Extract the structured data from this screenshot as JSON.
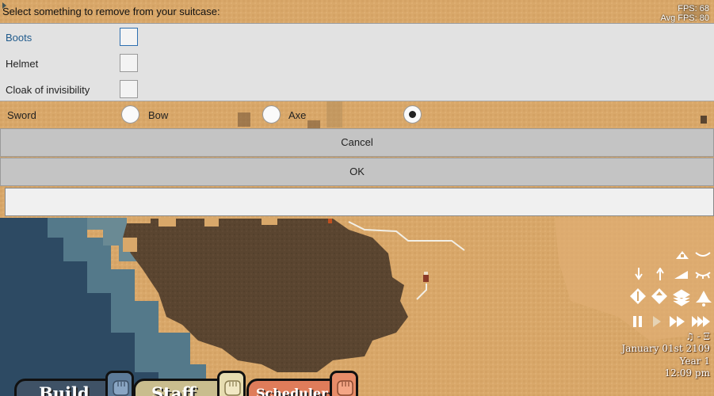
{
  "dialog": {
    "prompt": "Select something to remove from your suitcase:",
    "checkboxes": [
      {
        "label": "Boots",
        "checked": false,
        "focused": true
      },
      {
        "label": "Helmet",
        "checked": false,
        "focused": false
      },
      {
        "label": "Cloak of invisibility",
        "checked": false,
        "focused": false
      }
    ],
    "radios": [
      {
        "label": "Sword",
        "selected": false
      },
      {
        "label": "Bow",
        "selected": false
      },
      {
        "label": "Axe",
        "selected": true
      }
    ],
    "cancel_label": "Cancel",
    "ok_label": "OK",
    "text_value": ""
  },
  "stats": {
    "fps": "FPS: 68",
    "avg_fps": "Avg FPS: 80"
  },
  "hud": {
    "icons": [
      "terrain-up-icon",
      "eye-closed-icon",
      "arrow-down-icon",
      "arrow-up-icon",
      "slope-icon",
      "eye-lashes-icon",
      "dig-down-icon",
      "build-up-icon",
      "layers-icon",
      "bell-icon",
      "pause-icon",
      "play-icon",
      "fast-forward-icon",
      "fastest-icon",
      "music-icon"
    ],
    "music": "♫ - Ξ",
    "date": "January 01st 2109",
    "year": "Year 1",
    "time": "12:09 pm"
  },
  "tabs": [
    {
      "label": "Build",
      "color": "#3f5266"
    },
    {
      "label": "Staff",
      "color": "#c9bd8e"
    },
    {
      "label": "Scheduler",
      "color": "#df7c5a"
    }
  ],
  "colors": {
    "sand": "#d9a86a",
    "mud": "#5a4530",
    "deep_water": "#2d4a63",
    "shallow_water": "#54798a"
  }
}
